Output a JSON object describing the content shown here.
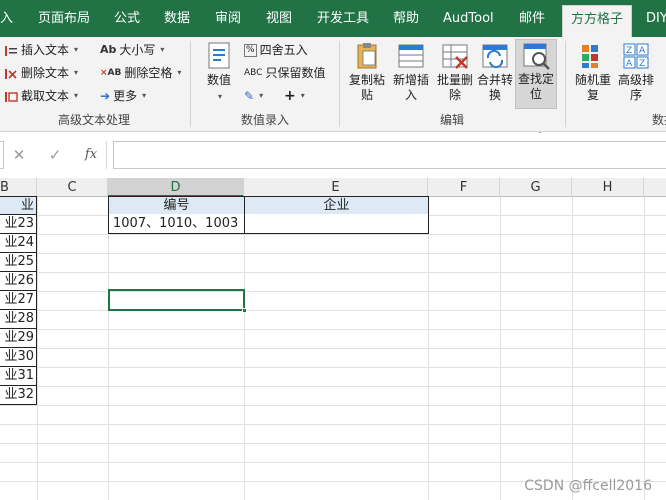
{
  "tabs": [
    {
      "label": "入",
      "active": false
    },
    {
      "label": "页面布局",
      "active": false
    },
    {
      "label": "公式",
      "active": false
    },
    {
      "label": "数据",
      "active": false
    },
    {
      "label": "审阅",
      "active": false
    },
    {
      "label": "视图",
      "active": false
    },
    {
      "label": "开发工具",
      "active": false
    },
    {
      "label": "帮助",
      "active": false
    },
    {
      "label": "AudTool",
      "active": false
    },
    {
      "label": "邮件",
      "active": false
    },
    {
      "label": "方方格子",
      "active": true
    },
    {
      "label": "DIY",
      "active": false
    }
  ],
  "ribbon": {
    "text_group": {
      "label": "高级文本处理",
      "insert_text": "插入文本",
      "delete_text": "删除文本",
      "extract_text": "截取文本",
      "case": "大小写",
      "delete_spaces": "删除空格",
      "more": "更多"
    },
    "number_group": {
      "label": "数值录入",
      "number": "数值",
      "round": "四舍五入",
      "keep_value": "只保留数值"
    },
    "edit_group": {
      "label": "编辑",
      "copy_paste": "复制粘贴",
      "new_insert": "新增插入",
      "batch_delete": "批量删除",
      "merge_convert": "合并转换",
      "find_locate": "查找定位"
    },
    "data_group": {
      "label": "数据",
      "random_repeat": "随机重复",
      "advanced_sort": "高级排序"
    }
  },
  "formula_bar": {
    "cancel": "✕",
    "enter": "✓",
    "fx": "fx",
    "value": ""
  },
  "columns": [
    "B",
    "C",
    "D",
    "E",
    "F",
    "G",
    "H"
  ],
  "b_header": "业",
  "b_values": [
    "业23",
    "业24",
    "业25",
    "业26",
    "业27",
    "业28",
    "业29",
    "业30",
    "业31",
    "业32"
  ],
  "table": {
    "header_d": "编号",
    "header_e": "企业",
    "d2": "1007、1010、1003",
    "e2": ""
  },
  "watermark": "CSDN @ffcell2016",
  "colors": {
    "accent": "#217346",
    "header_fill": "#dde9f4"
  }
}
